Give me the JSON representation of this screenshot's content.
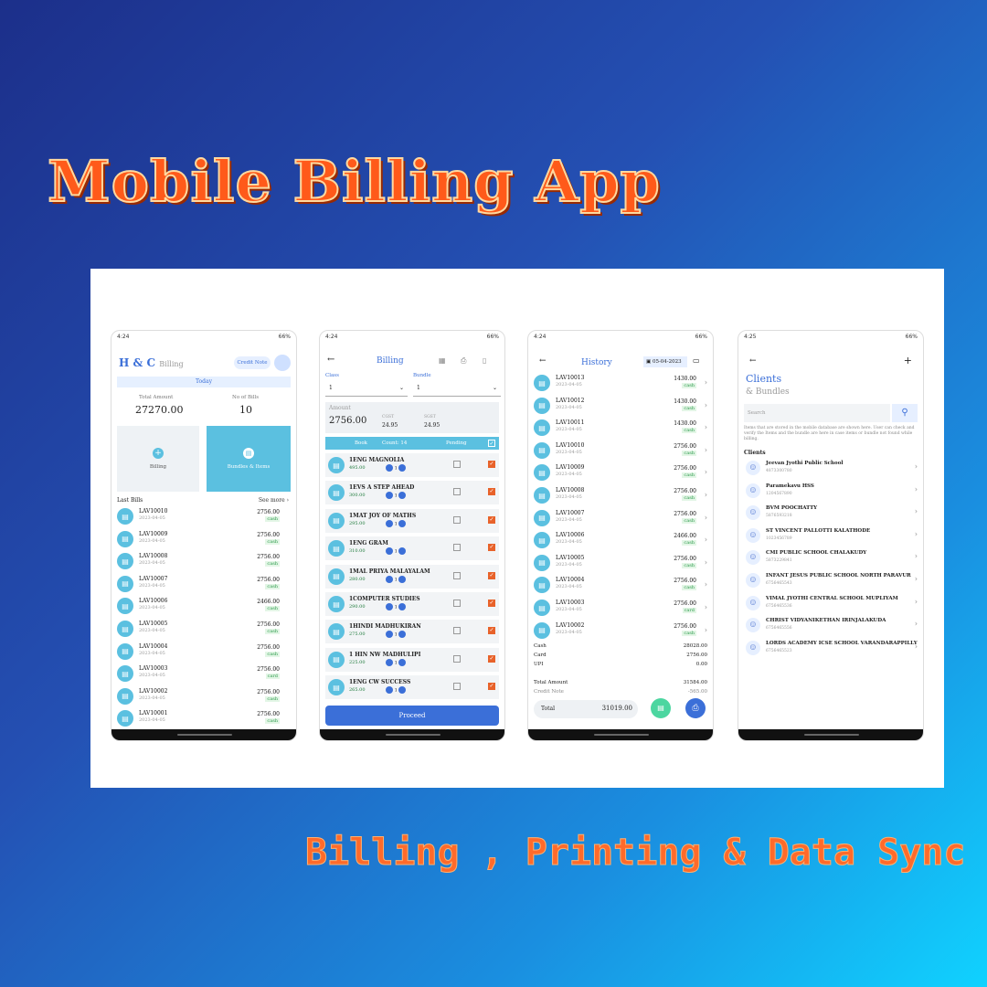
{
  "hero_title": "Mobile Billing App",
  "tagline": "Billing , Printing & Data Sync",
  "status": {
    "time1": "4:24",
    "time4": "4:25",
    "battery": "66%"
  },
  "home": {
    "logo": "H & C",
    "logo_sub": "Billing",
    "credit_note": "Credit Note",
    "today": "Today",
    "total_label": "Total Amount",
    "total_value": "27270.00",
    "bills_label": "No of Bills",
    "bills_value": "10",
    "tile_billing": "Billing",
    "tile_bundles": "Bundles & Items",
    "last_bills": "Last Bills",
    "see_more": "See more",
    "rows": [
      {
        "id": "LAV10010",
        "date": "2023-04-05",
        "amt": "2756.00",
        "mode": "cash"
      },
      {
        "id": "LAV10009",
        "date": "2023-04-05",
        "amt": "2756.00",
        "mode": "cash"
      },
      {
        "id": "LAV10008",
        "date": "2023-04-05",
        "amt": "2756.00",
        "mode": "cash"
      },
      {
        "id": "LAV10007",
        "date": "2023-04-05",
        "amt": "2756.00",
        "mode": "cash"
      },
      {
        "id": "LAV10006",
        "date": "2023-04-05",
        "amt": "2466.00",
        "mode": "cash"
      },
      {
        "id": "LAV10005",
        "date": "2023-04-05",
        "amt": "2756.00",
        "mode": "cash"
      },
      {
        "id": "LAV10004",
        "date": "2023-04-05",
        "amt": "2756.00",
        "mode": "cash"
      },
      {
        "id": "LAV10003",
        "date": "2023-04-05",
        "amt": "2756.00",
        "mode": "card"
      },
      {
        "id": "LAV10002",
        "date": "2023-04-05",
        "amt": "2756.00",
        "mode": "cash"
      },
      {
        "id": "LAV10001",
        "date": "2023-04-05",
        "amt": "2756.00",
        "mode": "cash"
      }
    ]
  },
  "billing": {
    "title": "Billing",
    "class_label": "Class",
    "class_value": "1",
    "bundle_label": "Bundle",
    "bundle_value": "1",
    "amount_label": "Amount",
    "amount_value": "2756.00",
    "cgst_label": "CGST",
    "cgst_value": "24.95",
    "sgst_label": "SGST",
    "sgst_value": "24.95",
    "h_book": "Book",
    "h_count": "Count: 14",
    "h_pending": "Pending",
    "proceed": "Proceed",
    "books": [
      {
        "name": "1ENG MAGNOLIA",
        "price": "495.00",
        "qty": "1"
      },
      {
        "name": "1EVS A STEP AHEAD",
        "price": "300.00",
        "qty": "1"
      },
      {
        "name": "1MAT JOY OF MATHS",
        "price": "295.00",
        "qty": "1"
      },
      {
        "name": "1ENG GRAM",
        "price": "310.00",
        "qty": "1"
      },
      {
        "name": "1MAL PRIYA MALAYALAM",
        "price": "280.00",
        "qty": "1"
      },
      {
        "name": "1COMPUTER STUDIES",
        "price": "290.00",
        "qty": "1"
      },
      {
        "name": "1HINDI MADHUKIRAN",
        "price": "275.00",
        "qty": "1"
      },
      {
        "name": "1 HIN NW MADHULIPI",
        "price": "225.00",
        "qty": "1"
      },
      {
        "name": "1ENG CW SUCCESS",
        "price": "265.00",
        "qty": "1"
      }
    ]
  },
  "history": {
    "title": "History",
    "date": "05-04-2023",
    "rows": [
      {
        "id": "LAV10013",
        "date": "2023-04-05",
        "amt": "1430.00",
        "mode": "cash"
      },
      {
        "id": "LAV10012",
        "date": "2023-04-05",
        "amt": "1430.00",
        "mode": "cash"
      },
      {
        "id": "LAV10011",
        "date": "2023-04-05",
        "amt": "1430.00",
        "mode": "cash"
      },
      {
        "id": "LAV10010",
        "date": "2023-04-05",
        "amt": "2756.00",
        "mode": "cash"
      },
      {
        "id": "LAV10009",
        "date": "2023-04-05",
        "amt": "2756.00",
        "mode": "cash"
      },
      {
        "id": "LAV10008",
        "date": "2023-04-05",
        "amt": "2756.00",
        "mode": "cash"
      },
      {
        "id": "LAV10007",
        "date": "2023-04-05",
        "amt": "2756.00",
        "mode": "cash"
      },
      {
        "id": "LAV10006",
        "date": "2023-04-05",
        "amt": "2466.00",
        "mode": "cash"
      },
      {
        "id": "LAV10005",
        "date": "2023-04-05",
        "amt": "2756.00",
        "mode": "cash"
      },
      {
        "id": "LAV10004",
        "date": "2023-04-05",
        "amt": "2756.00",
        "mode": "cash"
      },
      {
        "id": "LAV10003",
        "date": "2023-04-05",
        "amt": "2756.00",
        "mode": "card"
      },
      {
        "id": "LAV10002",
        "date": "2023-04-05",
        "amt": "2756.00",
        "mode": "cash"
      }
    ],
    "cash_l": "Cash",
    "cash_v": "28028.00",
    "card_l": "Card",
    "card_v": "2756.00",
    "upi_l": "UPI",
    "upi_v": "0.00",
    "total_amt_l": "Total Amount",
    "total_amt_v": "31584.00",
    "credit_l": "Credit Note",
    "credit_v": "-565.00",
    "total_l": "Total",
    "total_v": "31019.00"
  },
  "clients": {
    "title": "Clients",
    "subtitle": "& Bundles",
    "search": "Search",
    "note": "Items that are stored in the mobile database are shown here. User can check and verify the Items and the bundle are here in case items or bundle not found while billing.",
    "clients_label": "Clients",
    "list": [
      {
        "name": "Jeevan Jyothi  Public School",
        "phone": "4873300780"
      },
      {
        "name": "Paramekavu HSS",
        "phone": "1204567890"
      },
      {
        "name": "BVM  POOCHATTY",
        "phone": "5876593218"
      },
      {
        "name": "ST VINCENT PALLOTTI KALATHODE",
        "phone": "1023456789"
      },
      {
        "name": "CMI PUBLIC SCHOOL CHALAKUDY",
        "phone": "5873229841"
      },
      {
        "name": "INFANT JESUS PUBLIC SCHOOL NORTH PARAVUR",
        "phone": "6756465543"
      },
      {
        "name": "VIMAL JYOTHI CENTRAL SCHOOL MUPLIYAM",
        "phone": "6756465536"
      },
      {
        "name": "CHRIST VIDYANIKETHAN IRINJALAKUDA",
        "phone": "6756465556"
      },
      {
        "name": "LORDS ACADEMY ICSE SCHOOL VARANDARAPPILLY",
        "phone": "6756465523"
      }
    ]
  }
}
